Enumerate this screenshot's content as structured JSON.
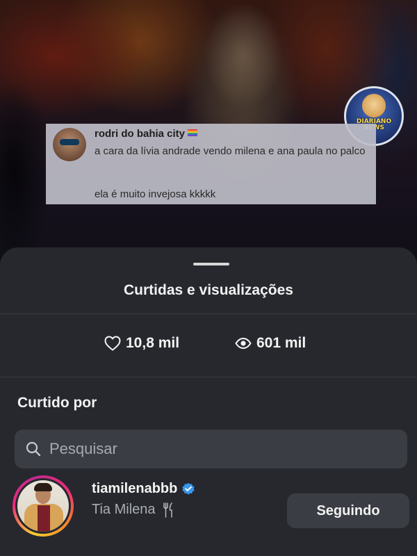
{
  "media": {
    "tweet": {
      "author": "rodri do bahia city",
      "text_line1": "a cara da lívia andrade vendo milena e ana paula no palco",
      "text_line2": "ela é muito invejosa kkkkk"
    },
    "badge_text": "DIARIANO NEWS"
  },
  "sheet": {
    "title": "Curtidas e visualizações",
    "likes": "10,8 mil",
    "views": "601 mil",
    "section_label": "Curtido por",
    "search": {
      "placeholder": "Pesquisar"
    }
  },
  "users": [
    {
      "username": "tiamilenabbb",
      "full_name": "Tia Milena",
      "verified": true,
      "button_label": "Seguindo"
    }
  ],
  "colors": {
    "sheet_bg": "#26282d",
    "control_bg": "#3a3d43",
    "verified_blue": "#3897f0"
  }
}
